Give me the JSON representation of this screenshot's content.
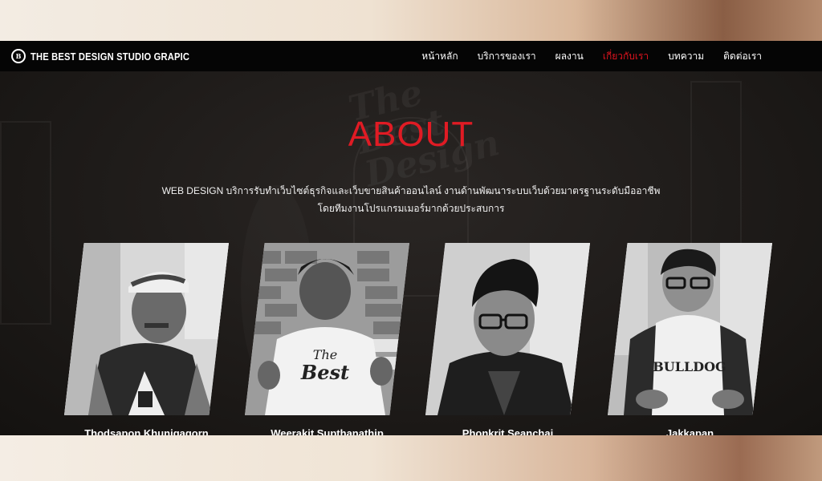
{
  "brand": {
    "logo_text": "THE BEST DESIGN STUDIO GRAPIC"
  },
  "nav": {
    "items": [
      {
        "label": "หน้าหลัก"
      },
      {
        "label": "บริการของเรา"
      },
      {
        "label": "ผลงาน"
      },
      {
        "label": "เกี่ยวกับเรา",
        "active": true
      },
      {
        "label": "บทความ"
      },
      {
        "label": "ติดต่อเรา"
      }
    ],
    "active_color": "#e0141f"
  },
  "about": {
    "title": "ABOUT",
    "title_color": "#e01b24",
    "description_line1": "WEB DESIGN บริการรับทำเว็บไซต์ธุรกิจและเว็บขายสินค้าออนไลน์ งานด้านพัฒนาระบบเว็บด้วยมาตรฐานระดับมืออาชีพ",
    "description_line2": "โดยทีมงานโปรแกรมเมอร์มากด้วยประสบการ"
  },
  "team": [
    {
      "name": "Thodsapon Khunjgagorn"
    },
    {
      "name": "Weerakit Supthanathip"
    },
    {
      "name": "Phonkrit Seanchai"
    },
    {
      "name": "Jakkapan"
    }
  ]
}
